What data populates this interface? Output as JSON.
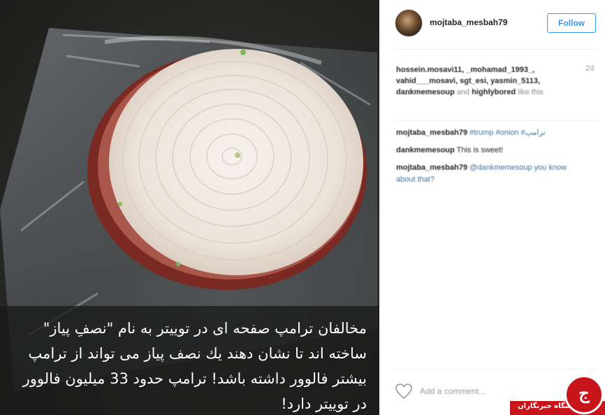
{
  "post": {
    "caption": "مخالفان ترامپ صفحه ای در توییتر به نام \"نصفِ پیاز\" ساخته اند تا نشان دهند یك نصف پیاز می تواند از ترامپ بیشتر فالوور داشته باشد! ترامپ حدود 33 میلیون فالوور در توییتر دارد!"
  },
  "header": {
    "username": "mojtaba_mesbah79",
    "follow_label": "Follow"
  },
  "likes": {
    "users": "hossein.mosavi11, _mohamad_1993_, vahid___mosavi, sgt_esi, yasmin_5113, dankmemesoup",
    "and": "and",
    "last_user": "highlybored",
    "suffix": "like this",
    "time": "2d"
  },
  "comments": [
    {
      "user": "mojtaba_mesbah79",
      "text": "#trump #onion #ترامپ"
    },
    {
      "user": "dankmemesoup",
      "text": "This is sweet!"
    },
    {
      "user": "mojtaba_mesbah79",
      "text": "@dankmemesoup you know about that?"
    }
  ],
  "comment_input": {
    "placeholder": "Add a comment..."
  },
  "watermark": {
    "label": "باشگاه خبرنگاران",
    "logo_glyph": "ج"
  },
  "colors": {
    "accent": "#3897f0",
    "badge": "#c8151c"
  }
}
